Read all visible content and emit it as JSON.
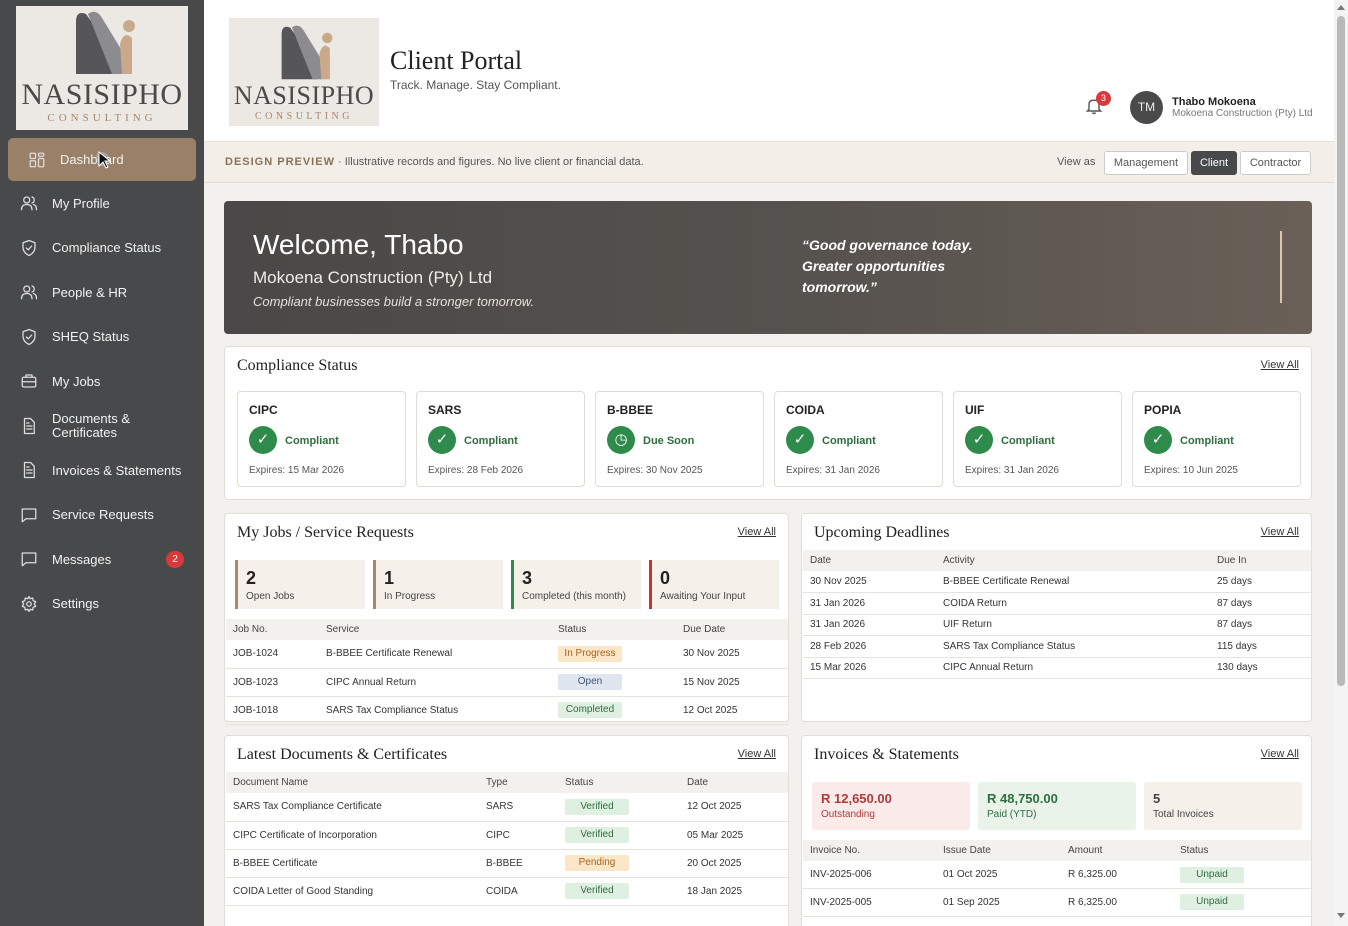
{
  "brand": {
    "name": "NASISIPHO",
    "sub": "CONSULTING"
  },
  "sidebar": {
    "items": [
      {
        "label": "Dashboard",
        "icon": "dashboard-icon",
        "active": true
      },
      {
        "label": "My Profile",
        "icon": "users-icon"
      },
      {
        "label": "Compliance Status",
        "icon": "shield-check-icon"
      },
      {
        "label": "People & HR",
        "icon": "users-icon"
      },
      {
        "label": "SHEQ Status",
        "icon": "shield-check-icon"
      },
      {
        "label": "My Jobs",
        "icon": "briefcase-icon"
      },
      {
        "label": "Documents & Certificates",
        "icon": "document-icon"
      },
      {
        "label": "Invoices & Statements",
        "icon": "document-icon"
      },
      {
        "label": "Service Requests",
        "icon": "chat-icon"
      },
      {
        "label": "Messages",
        "icon": "chat-icon",
        "badge": "2"
      },
      {
        "label": "Settings",
        "icon": "gear-icon"
      }
    ]
  },
  "header": {
    "title": "Client Portal",
    "subtitle": "Track. Manage. Stay Compliant.",
    "notifications": "3",
    "user": {
      "initials": "TM",
      "name": "Thabo Mokoena",
      "company": "Mokoena Construction (Pty) Ltd"
    }
  },
  "preview": {
    "label": "DESIGN PREVIEW",
    "note": " · Illustrative records and figures. No live client or financial data.",
    "view_as": "View as",
    "buttons": [
      "Management",
      "Client",
      "Contractor"
    ],
    "selected": "Client"
  },
  "welcome": {
    "title": "Welcome, Thabo",
    "company": "Mokoena Construction (Pty) Ltd",
    "tagline": "Compliant businesses build a stronger tomorrow.",
    "quote": "“Good governance today. Greater opportunities tomorrow.”"
  },
  "compliance": {
    "title": "Compliance Status",
    "view_all": "View All",
    "cards": [
      {
        "name": "CIPC",
        "status": "Compliant",
        "expires": "Expires: 15 Mar 2026",
        "kind": "ok"
      },
      {
        "name": "SARS",
        "status": "Compliant",
        "expires": "Expires: 28 Feb 2026",
        "kind": "ok"
      },
      {
        "name": "B-BBEE",
        "status": "Due Soon",
        "expires": "Expires: 30 Nov 2025",
        "kind": "soon"
      },
      {
        "name": "COIDA",
        "status": "Compliant",
        "expires": "Expires: 31 Jan 2026",
        "kind": "ok"
      },
      {
        "name": "UIF",
        "status": "Compliant",
        "expires": "Expires: 31 Jan 2026",
        "kind": "ok"
      },
      {
        "name": "POPIA",
        "status": "Compliant",
        "expires": "Expires: 10 Jun 2025",
        "kind": "ok"
      }
    ]
  },
  "jobs": {
    "title": "My Jobs / Service Requests",
    "view_all": "View All",
    "stats": [
      {
        "num": "2",
        "label": "Open Jobs",
        "color": "#a8876a"
      },
      {
        "num": "1",
        "label": "In Progress",
        "color": "#a8876a"
      },
      {
        "num": "3",
        "label": "Completed (this month)",
        "color": "#2e8b4c"
      },
      {
        "num": "0",
        "label": "Awaiting Your Input",
        "color": "#c0392b"
      }
    ],
    "columns": [
      "Job No.",
      "Service",
      "Status",
      "Due Date"
    ],
    "rows": [
      [
        "JOB-1024",
        "B-BBEE Certificate Renewal",
        "In Progress",
        "30 Nov 2025"
      ],
      [
        "JOB-1023",
        "CIPC Annual Return",
        "Open",
        "15 Nov 2025"
      ],
      [
        "JOB-1018",
        "SARS Tax Compliance Status",
        "Completed",
        "12 Oct 2025"
      ]
    ]
  },
  "deadlines": {
    "title": "Upcoming Deadlines",
    "view_all": "View All",
    "columns": [
      "Date",
      "Activity",
      "Due In"
    ],
    "rows": [
      [
        "30 Nov 2025",
        "B-BBEE Certificate Renewal",
        "25 days"
      ],
      [
        "31 Jan 2026",
        "COIDA Return",
        "87 days"
      ],
      [
        "31 Jan 2026",
        "UIF Return",
        "87 days"
      ],
      [
        "28 Feb 2026",
        "SARS Tax Compliance Status",
        "115 days"
      ],
      [
        "15 Mar 2026",
        "CIPC Annual Return",
        "130 days"
      ]
    ]
  },
  "documents": {
    "title": "Latest Documents & Certificates",
    "view_all": "View All",
    "columns": [
      "Document Name",
      "Type",
      "Status",
      "Date"
    ],
    "rows": [
      [
        "SARS Tax Compliance Certificate",
        "SARS",
        "Verified",
        "12 Oct 2025"
      ],
      [
        "CIPC Certificate of Incorporation",
        "CIPC",
        "Verified",
        "05 Mar 2025"
      ],
      [
        "B-BBEE Certificate",
        "B-BBEE",
        "Pending",
        "20 Oct 2025"
      ],
      [
        "COIDA Letter of Good Standing",
        "COIDA",
        "Verified",
        "18 Jan 2025"
      ]
    ]
  },
  "invoices": {
    "title": "Invoices & Statements",
    "view_all": "View All",
    "summary": [
      {
        "value": "R 12,650.00",
        "label": "Outstanding",
        "bg": "#fbeaea",
        "fg": "#b03a3a"
      },
      {
        "value": "R 48,750.00",
        "label": "Paid (YTD)",
        "bg": "#e9f3ea",
        "fg": "#2e6e3f"
      },
      {
        "value": "5",
        "label": "Total Invoices",
        "bg": "#f5f1ea",
        "fg": "#444"
      }
    ],
    "columns": [
      "Invoice No.",
      "Issue Date",
      "Amount",
      "Status"
    ],
    "rows": [
      [
        "INV-2025-006",
        "01 Oct 2025",
        "R 6,325.00",
        "Unpaid"
      ],
      [
        "INV-2025-005",
        "01 Sep 2025",
        "R 6,325.00",
        "Unpaid"
      ]
    ]
  }
}
